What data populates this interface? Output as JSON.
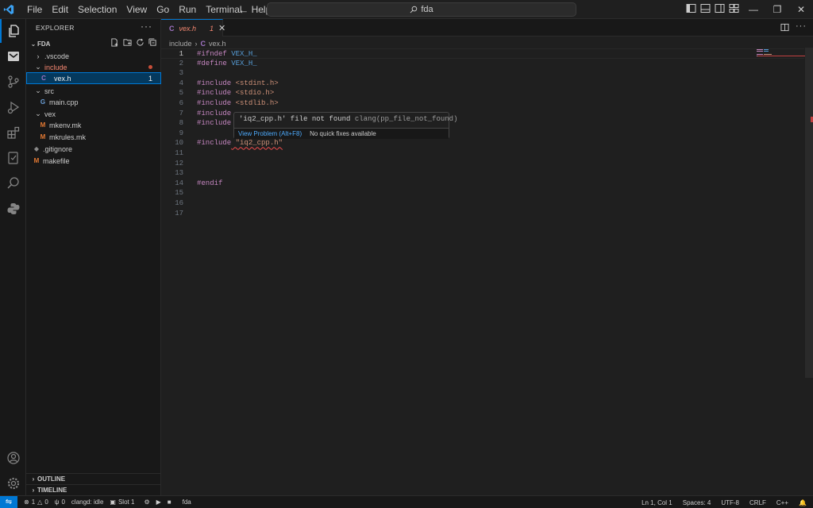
{
  "menu": [
    "File",
    "Edit",
    "Selection",
    "View",
    "Go",
    "Run",
    "Terminal",
    "Help"
  ],
  "command_center": {
    "label": "fda"
  },
  "explorer": {
    "title": "EXPLORER",
    "folder": "FDA",
    "items": [
      {
        "label": ".vscode",
        "kind": "folder",
        "collapsed": true,
        "indent": 1
      },
      {
        "label": "include",
        "kind": "folder",
        "collapsed": false,
        "indent": 1,
        "error": true
      },
      {
        "label": "vex.h",
        "kind": "c",
        "indent": 2,
        "selected": true,
        "badge": "1"
      },
      {
        "label": "src",
        "kind": "folder",
        "collapsed": false,
        "indent": 1
      },
      {
        "label": "main.cpp",
        "kind": "cpp",
        "indent": 2
      },
      {
        "label": "vex",
        "kind": "folder",
        "collapsed": false,
        "indent": 1
      },
      {
        "label": "mkenv.mk",
        "kind": "make",
        "indent": 2
      },
      {
        "label": "mkrules.mk",
        "kind": "make",
        "indent": 2
      },
      {
        "label": ".gitignore",
        "kind": "git",
        "indent": 1
      },
      {
        "label": "makefile",
        "kind": "make",
        "indent": 1
      }
    ],
    "outline": "OUTLINE",
    "timeline": "TIMELINE"
  },
  "tab": {
    "name": "vex.h",
    "problems": "1"
  },
  "breadcrumb": {
    "folder": "include",
    "file": "vex.h"
  },
  "code_lines": [
    {
      "n": "1",
      "kw": "#ifndef",
      "rest": " VEX_H_",
      "restClass": "mac"
    },
    {
      "n": "2",
      "kw": "#define",
      "rest": " VEX_H_",
      "restClass": "mac"
    },
    {
      "n": "3",
      "kw": "",
      "rest": ""
    },
    {
      "n": "4",
      "kw": "#include",
      "rest": " <stdint.h>",
      "restClass": "str"
    },
    {
      "n": "5",
      "kw": "#include",
      "rest": " <stdio.h>",
      "restClass": "str"
    },
    {
      "n": "6",
      "kw": "#include",
      "rest": " <stdlib.h>",
      "restClass": "str"
    },
    {
      "n": "7",
      "kw": "#include",
      "rest": ""
    },
    {
      "n": "8",
      "kw": "#include",
      "rest": ""
    },
    {
      "n": "9",
      "kw": "",
      "rest": ""
    },
    {
      "n": "10",
      "kw": "#include",
      "rest": " \"iq2_cpp.h\"",
      "restClass": "str",
      "error": true
    },
    {
      "n": "11",
      "kw": "",
      "rest": ""
    },
    {
      "n": "12",
      "kw": "",
      "rest": ""
    },
    {
      "n": "13",
      "kw": "",
      "rest": ""
    },
    {
      "n": "14",
      "kw": "#endif",
      "rest": ""
    },
    {
      "n": "15",
      "kw": "",
      "rest": ""
    },
    {
      "n": "16",
      "kw": "",
      "rest": ""
    },
    {
      "n": "17",
      "kw": "",
      "rest": ""
    }
  ],
  "hover": {
    "message": "'iq2_cpp.h' file not found",
    "source": "clang(pp_file_not_found)",
    "view_problem": "View Problem (Alt+F8)",
    "no_fixes": "No quick fixes available"
  },
  "status": {
    "errors": "1",
    "warnings": "0",
    "ports": "0",
    "clangd": "clangd: idle",
    "slot": "Slot 1",
    "project": "fda",
    "position": "Ln 1, Col 1",
    "spaces": "Spaces: 4",
    "encoding": "UTF-8",
    "eol": "CRLF",
    "language": "C++"
  },
  "colors": {
    "accent": "#0078d4",
    "error": "#f14c4c",
    "keyword": "#c586c0",
    "string": "#ce9178",
    "macro": "#569cd6"
  }
}
